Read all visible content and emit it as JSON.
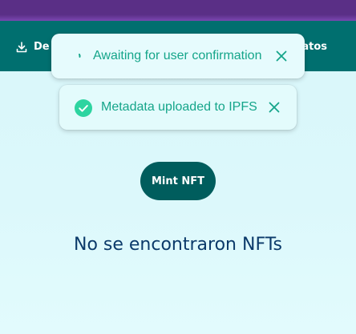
{
  "header": {
    "nav_left_label": "De",
    "nav_right_label": "atos",
    "download_icon": "download-icon"
  },
  "toasts": [
    {
      "message": "Awaiting for user confirmation",
      "status_icon": "spinner-icon",
      "close_icon": "close-icon"
    },
    {
      "message": "Metadata uploaded to IPFS",
      "status_icon": "check-circle-icon",
      "close_icon": "close-icon"
    }
  ],
  "main": {
    "mint_button_label": "Mint NFT",
    "empty_message": "No se encontraron NFTs"
  },
  "colors": {
    "top_bar": "#5a2f86",
    "navbar": "#006f6f",
    "toast_text": "#15a58a",
    "success": "#2dd4a0",
    "mint_button": "#005d5d",
    "empty_text": "#0b3a6a",
    "page_background": "#dbf7fa"
  }
}
